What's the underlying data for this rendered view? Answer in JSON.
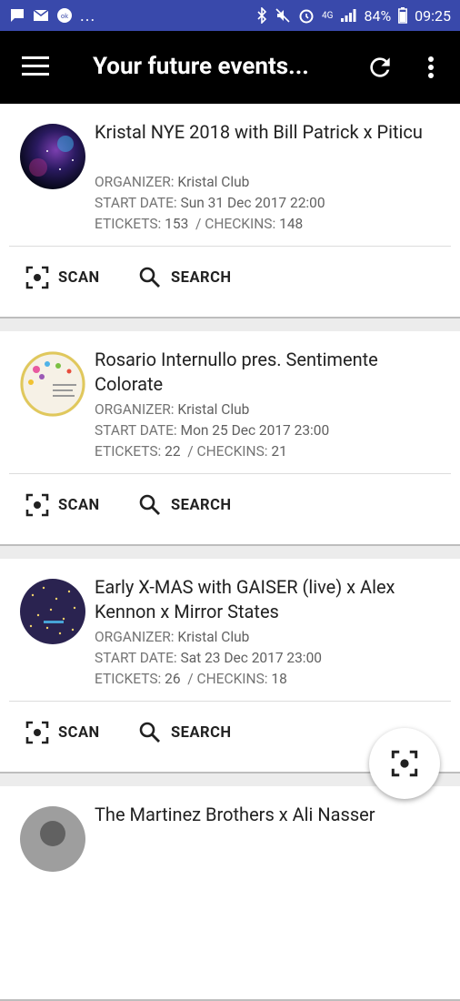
{
  "status_bar": {
    "overflow": "...",
    "network": "4G",
    "battery": "84%",
    "time": "09:25"
  },
  "app_bar": {
    "title": "Your future events...",
    "icons": [
      "menu-icon",
      "refresh-icon",
      "more-vert-icon"
    ]
  },
  "labels": {
    "organizer": "ORGANIZER:",
    "start_date": "START DATE:",
    "etickets": "ETICKETS:",
    "checkins": "/ CHECKINS:",
    "scan": "SCAN",
    "search": "SEARCH"
  },
  "events": [
    {
      "title": "Kristal NYE 2018 with Bill Patrick x Piticu",
      "organizer": "Kristal Club",
      "start_date": "Sun 31 Dec 2017 22:00",
      "etickets": "153",
      "checkins": "148"
    },
    {
      "title": "Rosario Internullo pres. Sentimente Colorate",
      "organizer": "Kristal Club",
      "start_date": "Mon 25 Dec 2017 23:00",
      "etickets": "22",
      "checkins": "21"
    },
    {
      "title": "Early X-MAS with GAISER (live) x Alex Kennon x Mirror States",
      "organizer": "Kristal Club",
      "start_date": "Sat 23 Dec 2017 23:00",
      "etickets": "26",
      "checkins": "18"
    },
    {
      "title": "The Martinez Brothers x Ali Nasser"
    }
  ],
  "colors": {
    "status_bar": "#3949ab",
    "app_bar": "#000000",
    "background": "#ececec"
  }
}
